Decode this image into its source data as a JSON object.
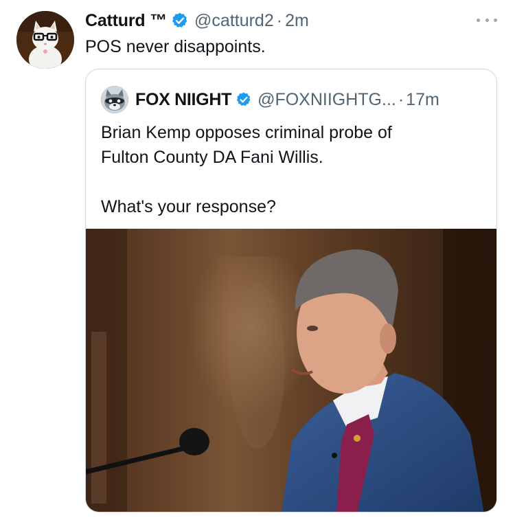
{
  "tweet": {
    "author_name": "Catturd ™",
    "handle": "@catturd2",
    "separator": "·",
    "time": "2m",
    "text": "POS never disappoints."
  },
  "quote": {
    "author_name": "FOX NIIGHT",
    "handle": "@FOXNIIGHTG...",
    "separator": "·",
    "time": "17m",
    "text_line_1": "Brian Kemp opposes criminal probe of",
    "text_line_2": "Fulton County DA Fani Willis.",
    "text_line_3": "What's your response?"
  },
  "colors": {
    "verified": "#1d9bf0",
    "secondary_text": "#536471",
    "border": "#cfd9de"
  },
  "icons": {
    "verified": "verified-badge-icon",
    "more": "more-options-icon"
  }
}
